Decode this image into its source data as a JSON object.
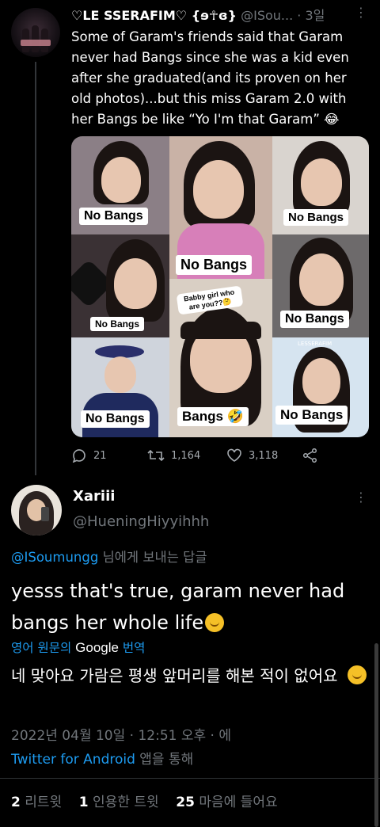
{
  "parent": {
    "name": "♡LE SSERAFIM♡ {ɘ☥ɞ}",
    "handle": "@ISou...",
    "sep": "·",
    "time": "3일",
    "more": "⋮",
    "text": "Some of Garam's friends said that Garam never had Bangs since she was a kid even after she graduated(and its proven on her old photos)...but this miss Garam 2.0 with her Bangs be like “Yo I'm that Garam” 😂",
    "image": {
      "labels": [
        "No Bangs",
        "No Bangs",
        "No Bangs",
        "No Bangs",
        "No Bangs",
        "No Bangs",
        "Bangs 🤣",
        "No Bangs"
      ],
      "caption": "Babby girl who are you??🤔",
      "watermark": "LESSERAFIM"
    },
    "actions": {
      "replies": "21",
      "retweets": "1,164",
      "likes": "3,118"
    }
  },
  "reply": {
    "name": "Xariii",
    "handle": "@HueningHiyyihhh",
    "more": "⋮",
    "reply_to_handle": "@ISoumungg",
    "reply_to_suffix": " 님에게 보내는 답글",
    "text": "yesss that's true, garam never had bangs her whole life",
    "translate_prefix": "영어 원문의 ",
    "translate_brand": "Google",
    "translate_suffix": " 번역",
    "translated_text": "네 맞아요 가람은 평생 앞머리를 해본 적이 없어요",
    "timestamp": "2022년 04월 10일 · 12:51 오후 · 에",
    "via_app": "Twitter for Android",
    "via_suffix": " 앱을 통해",
    "stats": {
      "retweets_count": "2",
      "retweets_label": "리트윗",
      "quotes_count": "1",
      "quotes_label": "인용한 트윗",
      "likes_count": "25",
      "likes_label": "마음에 들어요"
    }
  },
  "colors": {
    "background": "#000000",
    "text": "#e7e9ea",
    "muted": "#71767b",
    "accent": "#1d9bf0"
  }
}
